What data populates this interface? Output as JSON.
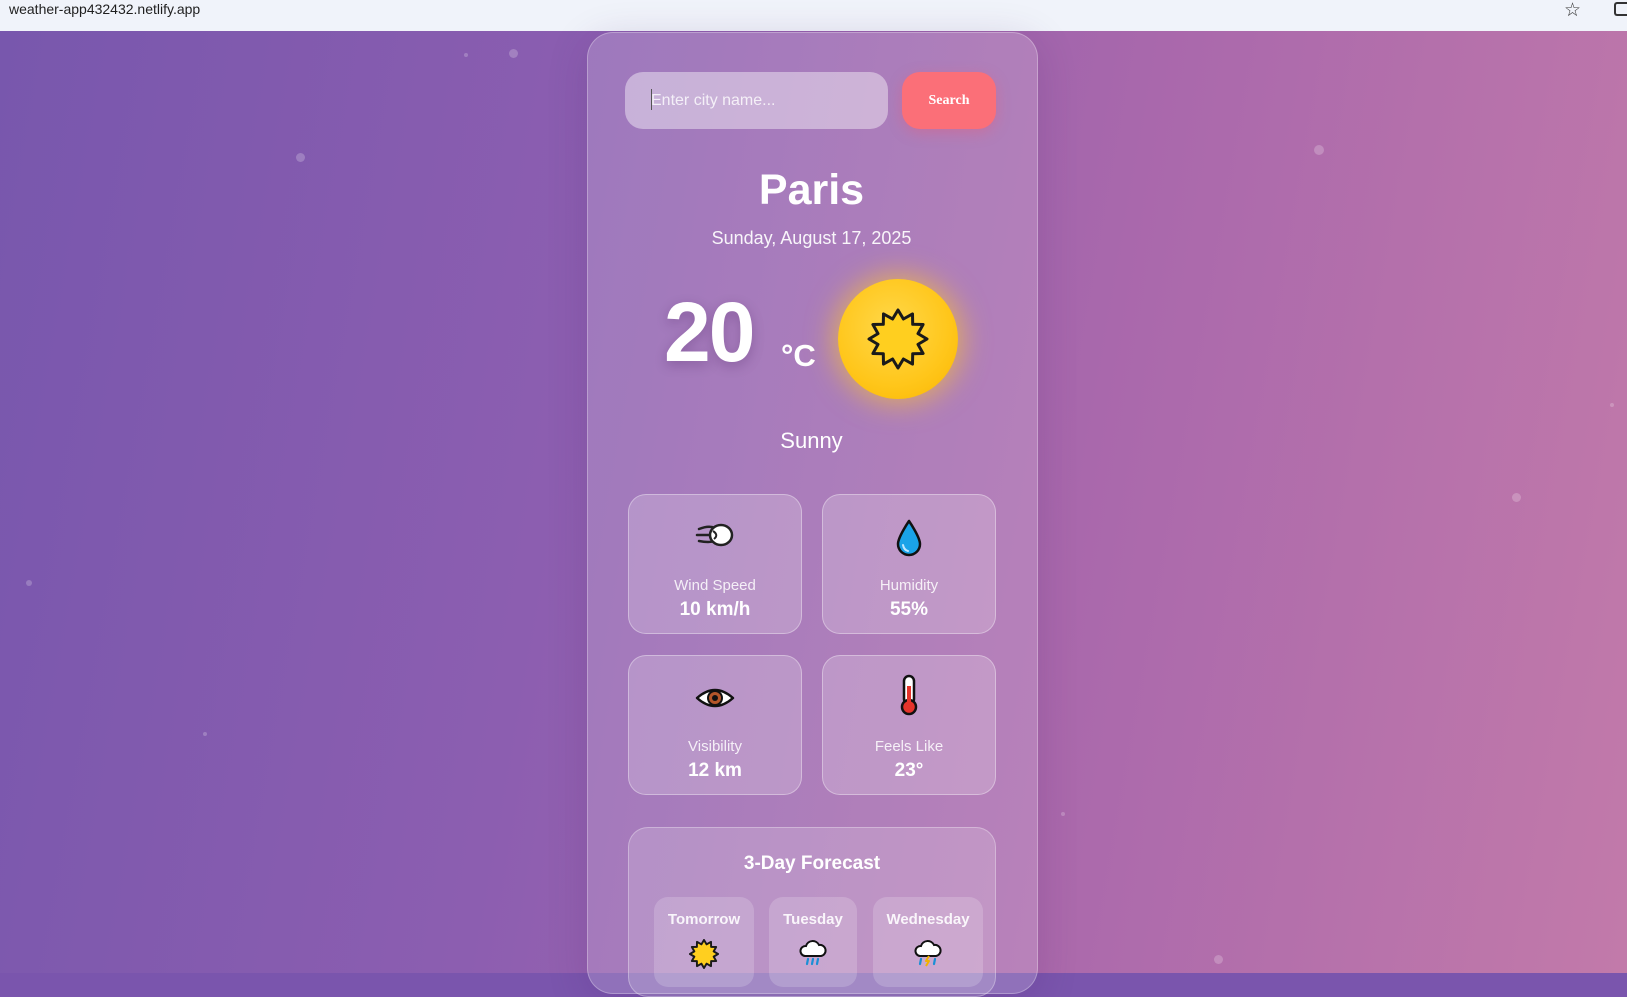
{
  "browser": {
    "url": "weather-app432432.netlify.app",
    "bookmark_icon": "star-icon"
  },
  "search": {
    "placeholder": "Enter city name...",
    "button_label": "Search",
    "value": ""
  },
  "weather": {
    "city": "Paris",
    "date": "Sunday, August 17, 2025",
    "temperature": "20",
    "unit": "°C",
    "condition": "Sunny",
    "icon": "sun-icon"
  },
  "details": [
    {
      "label": "Wind Speed",
      "value": "10 km/h",
      "icon": "wind-icon"
    },
    {
      "label": "Humidity",
      "value": "55%",
      "icon": "droplet-icon"
    },
    {
      "label": "Visibility",
      "value": "12 km",
      "icon": "eye-icon"
    },
    {
      "label": "Feels Like",
      "value": "23°",
      "icon": "thermometer-icon"
    }
  ],
  "forecast": {
    "title": "3-Day Forecast",
    "days": [
      {
        "name": "Tomorrow",
        "icon": "sun-icon"
      },
      {
        "name": "Tuesday",
        "icon": "rain-cloud-icon"
      },
      {
        "name": "Wednesday",
        "icon": "storm-cloud-icon"
      }
    ]
  },
  "colors": {
    "search_button": "#fb6f78",
    "sun": "#ffc61a",
    "background_start": "#7857ad",
    "background_end": "#c27aaa"
  }
}
